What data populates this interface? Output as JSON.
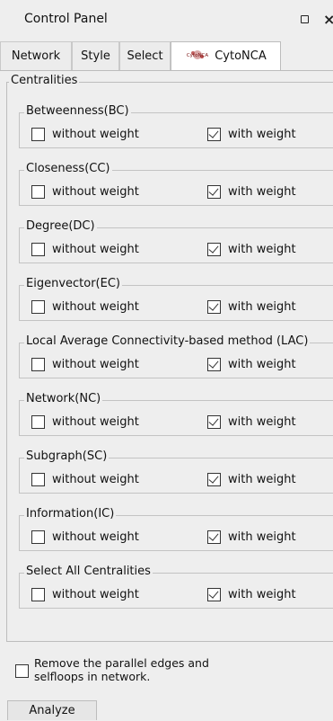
{
  "window": {
    "title": "Control Panel"
  },
  "tabs": [
    {
      "label": "Network"
    },
    {
      "label": "Style"
    },
    {
      "label": "Select"
    },
    {
      "label": "CytoNCA",
      "logo_text": "CytoNCA"
    }
  ],
  "centralities": {
    "title": "Centralities",
    "groups": [
      {
        "title": "Betweenness(BC)",
        "without_label": "without weight",
        "with_label": "with weight",
        "without_checked": false,
        "with_checked": true
      },
      {
        "title": "Closeness(CC)",
        "without_label": "without weight",
        "with_label": "with weight",
        "without_checked": false,
        "with_checked": true
      },
      {
        "title": "Degree(DC)",
        "without_label": "without weight",
        "with_label": "with weight",
        "without_checked": false,
        "with_checked": true
      },
      {
        "title": "Eigenvector(EC)",
        "without_label": "without weight",
        "with_label": "with weight",
        "without_checked": false,
        "with_checked": true
      },
      {
        "title": "Local Average Connectivity-based method (LAC)",
        "without_label": "without weight",
        "with_label": "with weight",
        "without_checked": false,
        "with_checked": true
      },
      {
        "title": "Network(NC)",
        "without_label": "without weight",
        "with_label": "with weight",
        "without_checked": false,
        "with_checked": true
      },
      {
        "title": "Subgraph(SC)",
        "without_label": "without weight",
        "with_label": "with weight",
        "without_checked": false,
        "with_checked": true
      },
      {
        "title": "Information(IC)",
        "without_label": "without weight",
        "with_label": "with weight",
        "without_checked": false,
        "with_checked": true
      },
      {
        "title": "Select All Centralities",
        "without_label": "without weight",
        "with_label": "with weight",
        "without_checked": false,
        "with_checked": true
      }
    ]
  },
  "remove_option": {
    "line1": "Remove the parallel edges and",
    "line2": "selfloops in network.",
    "checked": false
  },
  "analyze_button": {
    "label": "Analyze"
  },
  "colors": {
    "panel_bg": "#eeeeee",
    "active_tab_bg": "#ffffff",
    "border": "#bdbdbd"
  }
}
